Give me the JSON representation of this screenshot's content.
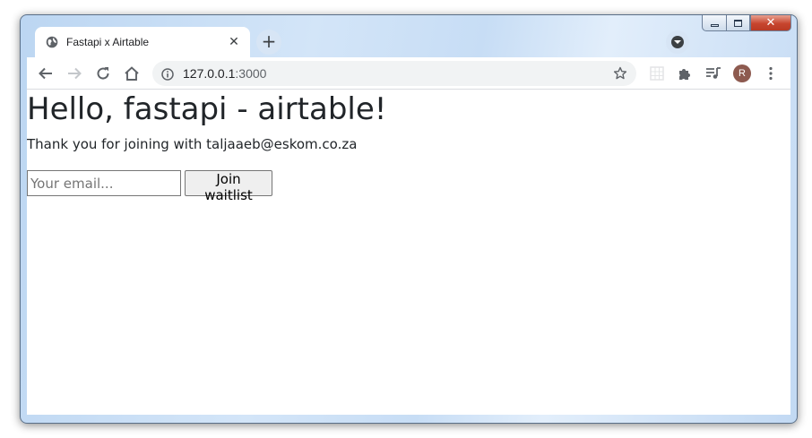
{
  "tab": {
    "title": "Fastapi x Airtable",
    "favicon": "globe-icon",
    "close_glyph": "✕"
  },
  "new_tab_glyph": "+",
  "caption": {
    "close_glyph": "✕"
  },
  "omnibox": {
    "host": "127.0.0.1",
    "port": ":3000"
  },
  "profile": {
    "initial": "R",
    "color": "#8d5a4f"
  },
  "page": {
    "title": "Hello, fastapi - airtable!",
    "thanks": "Thank you for joining with taljaaeb@eskom.co.za",
    "email_placeholder": "Your email...",
    "join_label": "Join waitlist"
  }
}
